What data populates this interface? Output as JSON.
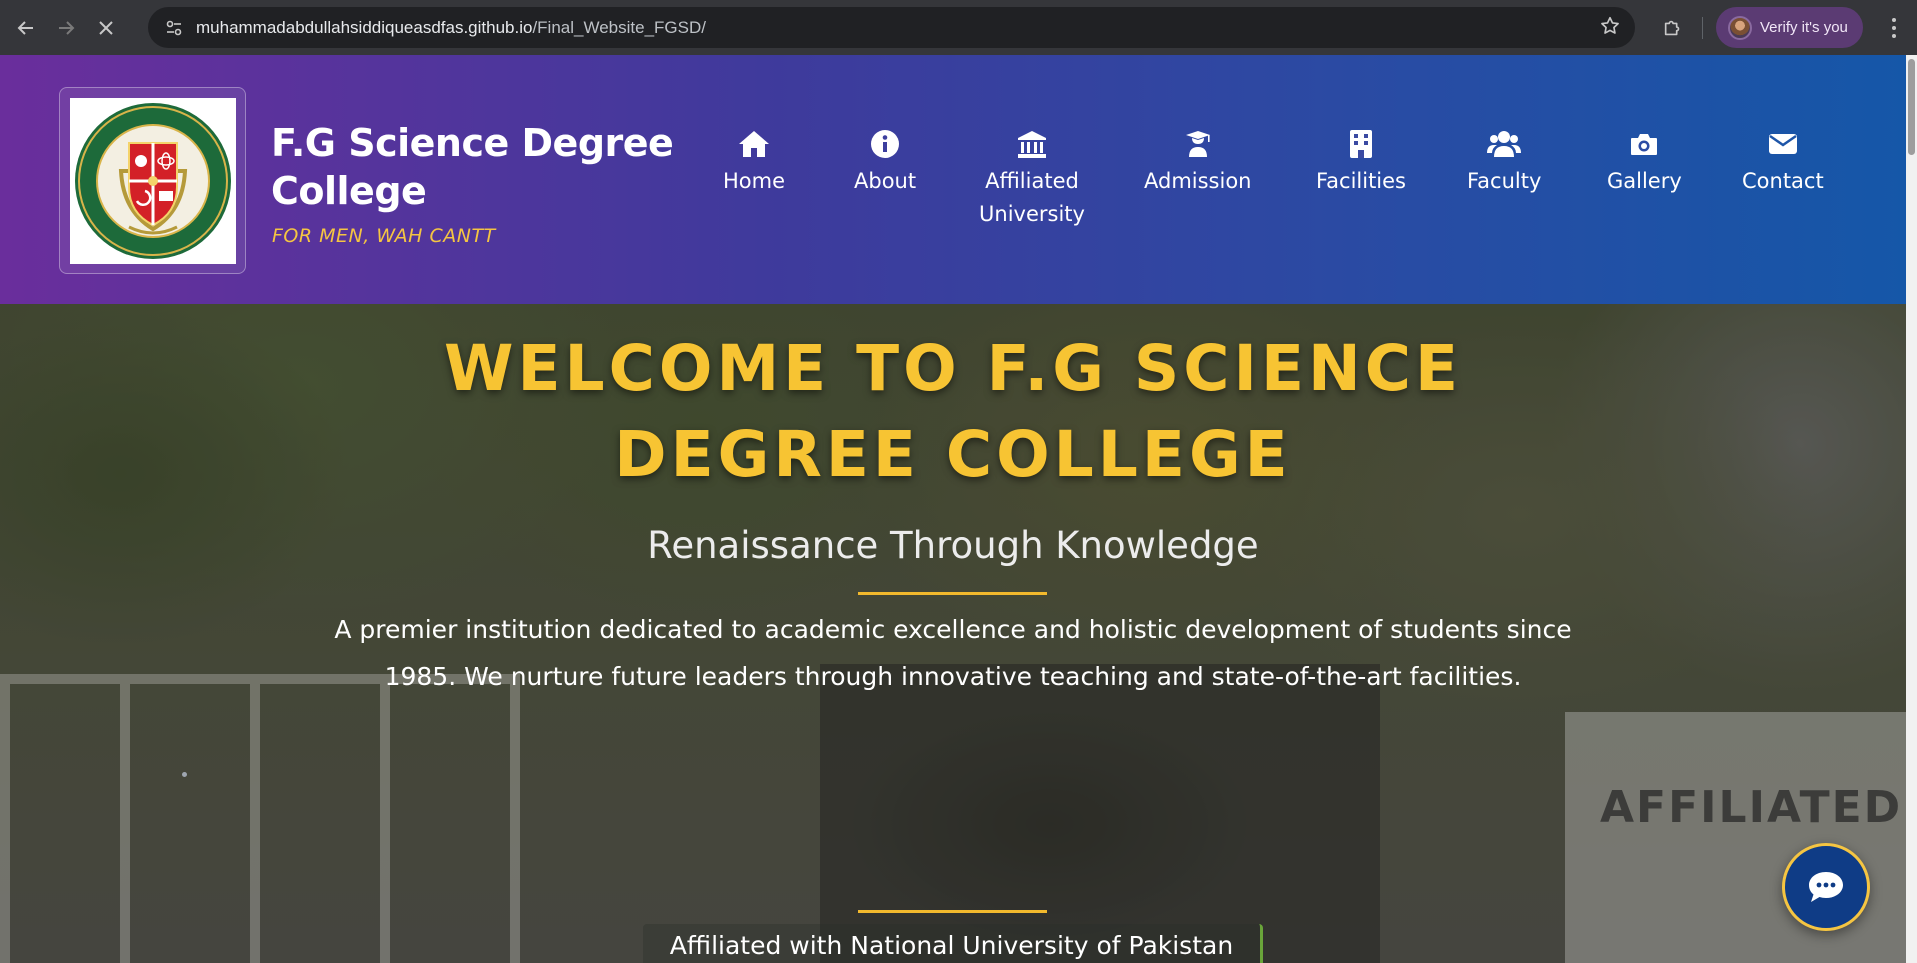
{
  "browser": {
    "url_host": "muhammadabdullahsiddiqueasdfas.github.io",
    "url_path": "/Final_Website_FGSD/",
    "profile_label": "Verify it's you"
  },
  "header": {
    "college_name": "F.G Science Degree College",
    "college_sub": "FOR MEN, WAH CANTT",
    "logo_text": "F.G SCIENCE DEGREE COLLEGE FOR MEN, WAH CANTT",
    "logo_motto": "RENAISSANCE THROUGH KNOWLEDGE"
  },
  "nav": {
    "home": "Home",
    "about": "About",
    "affiliated": "Affiliated University",
    "admission": "Admission",
    "facilities": "Facilities",
    "faculty": "Faculty",
    "gallery": "Gallery",
    "contact": "Contact"
  },
  "hero": {
    "title": "WELCOME TO F.G SCIENCE DEGREE COLLEGE",
    "tagline": "Renaissance Through Knowledge",
    "description": "A premier institution dedicated to academic excellence and holistic development of students since 1985. We nurture future leaders through innovative teaching and state-of-the-art facilities.",
    "affiliation": "Affiliated with National University of Pakistan",
    "background_sign": "AFFILIATED WI"
  },
  "colors": {
    "accent_gold": "#f7c433",
    "header_gradient_start": "#6a2e9c",
    "header_gradient_end": "#1557a8",
    "badge_border": "#6aa53a",
    "chat_button": "#0f3c86"
  },
  "icons": {
    "home": "home-icon",
    "about": "info-icon",
    "affiliated": "university-icon",
    "admission": "graduation-cap-icon",
    "facilities": "building-icon",
    "faculty": "users-icon",
    "gallery": "camera-icon",
    "contact": "envelope-icon",
    "chat": "chat-icon"
  }
}
